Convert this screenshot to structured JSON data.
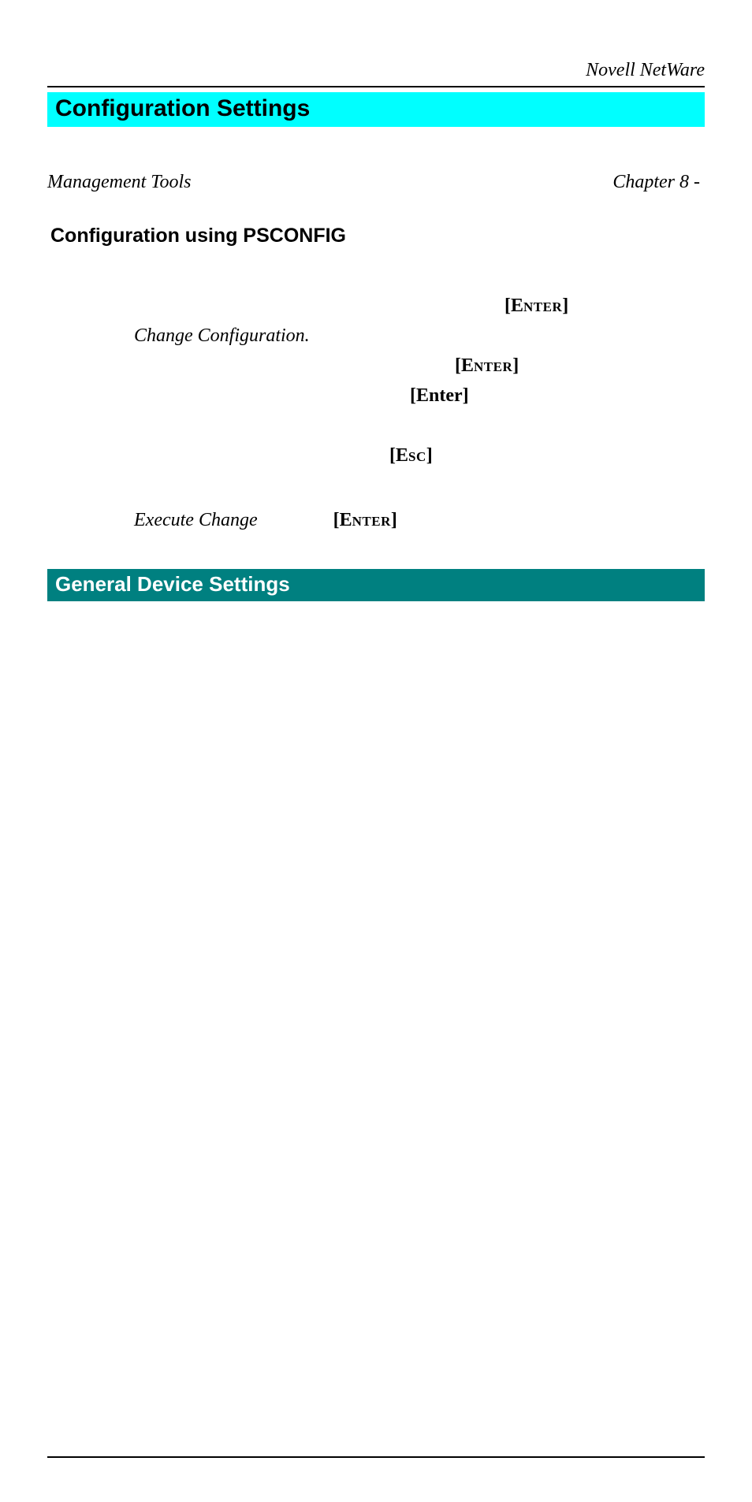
{
  "header": {
    "running_title": "Novell NetWare"
  },
  "section": {
    "title": "Configuration Settings"
  },
  "chapter_ref": {
    "right_text": "Chapter 8 - ",
    "left_text": "Management Tools"
  },
  "subheading": "Configuration using PSCONFIG",
  "body": {
    "enter_key_cap": "E",
    "enter_key_rest": "nter",
    "enter_key_plain": "Enter",
    "esc_key_cap": "E",
    "esc_key_rest": "sc",
    "change_configuration": "Change Configuration.",
    "execute_change": "Execute Change"
  },
  "section2": {
    "title": "General Device Settings"
  }
}
